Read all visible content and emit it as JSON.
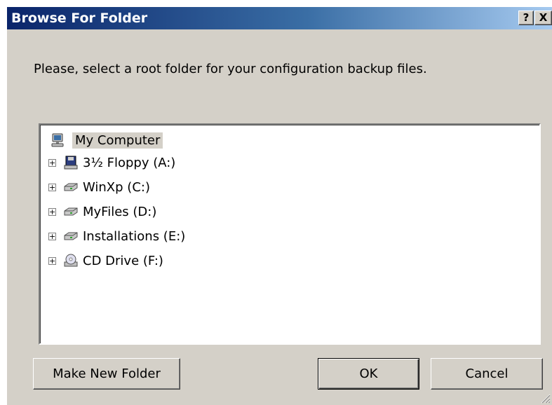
{
  "window": {
    "title": "Browse For Folder"
  },
  "titlebar": {
    "help_label": "?",
    "close_label": "X"
  },
  "prompt": "Please, select a root folder for your configuration backup files.",
  "tree": {
    "root": {
      "label": "My Computer",
      "icon": "my-computer-icon"
    },
    "items": [
      {
        "label": "3½ Floppy (A:)",
        "icon": "floppy-drive-icon",
        "expander": "+"
      },
      {
        "label": "WinXp (C:)",
        "icon": "hard-drive-icon",
        "expander": "+"
      },
      {
        "label": "MyFiles (D:)",
        "icon": "hard-drive-icon",
        "expander": "+"
      },
      {
        "label": "Installations (E:)",
        "icon": "hard-drive-icon",
        "expander": "+"
      },
      {
        "label": "CD Drive (F:)",
        "icon": "cd-drive-icon",
        "expander": "+"
      }
    ]
  },
  "buttons": {
    "make_new_folder": "Make New Folder",
    "ok": "OK",
    "cancel": "Cancel"
  }
}
